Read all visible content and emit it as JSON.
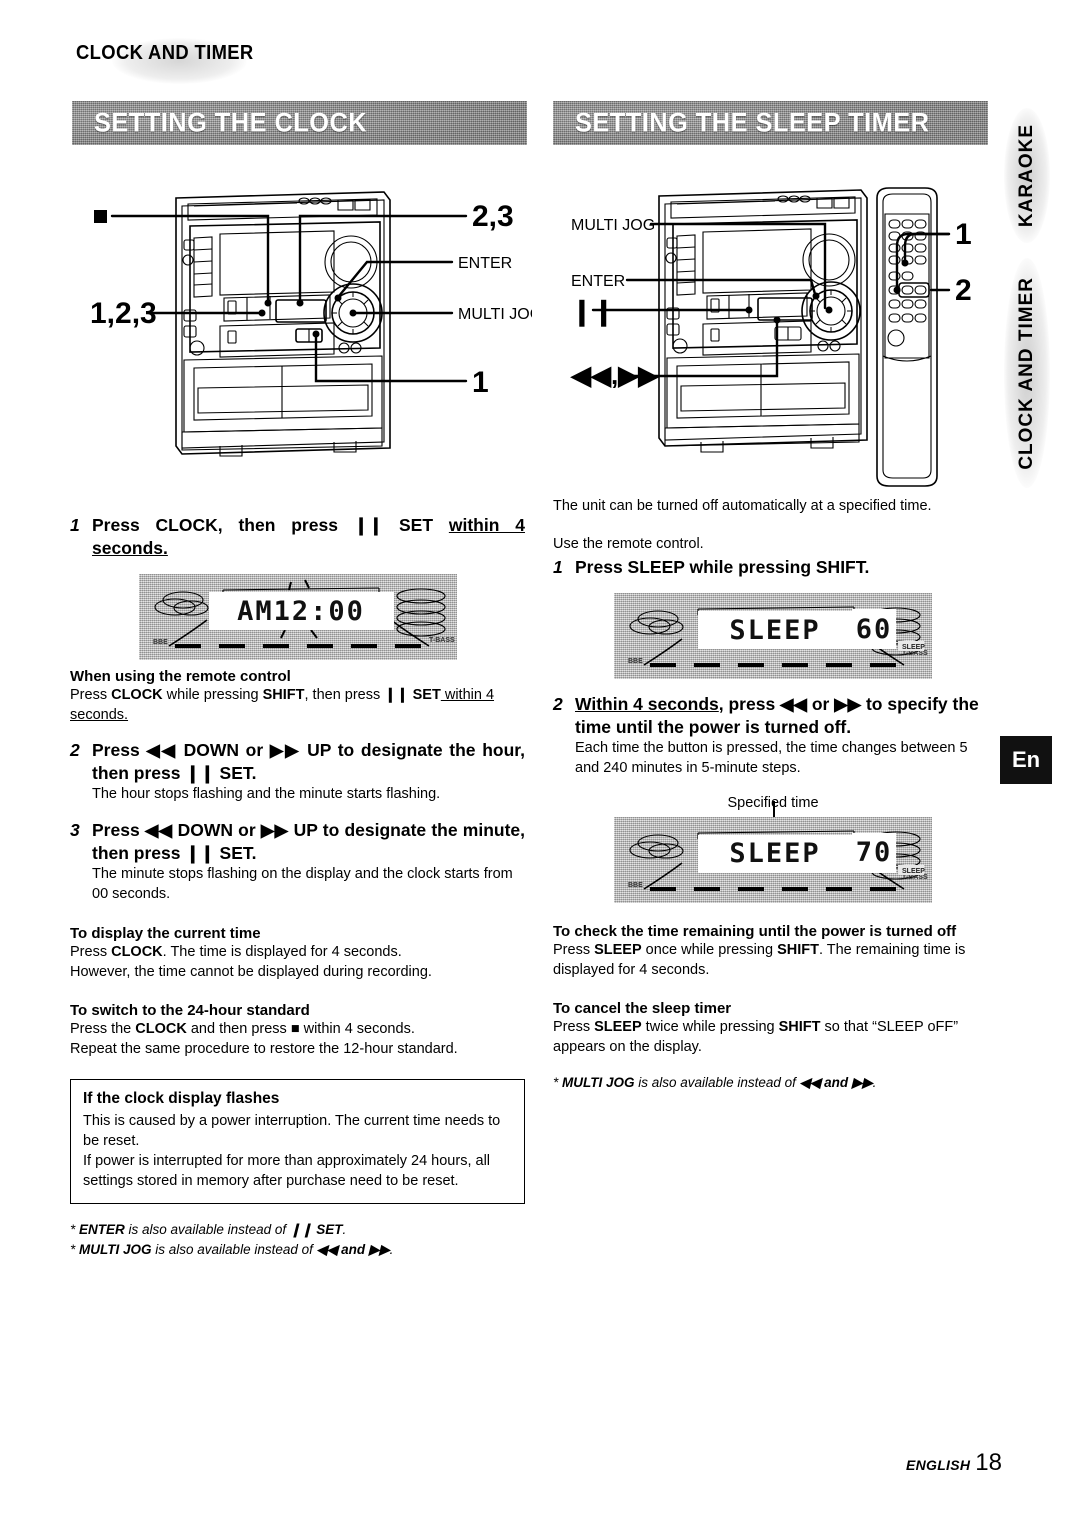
{
  "page": {
    "chapter_title": "CLOCK AND TIMER",
    "language_badge": "En",
    "footer_label": "ENGLISH",
    "footer_page": "18"
  },
  "side_tabs": [
    {
      "label": "KARAOKE"
    },
    {
      "label": "CLOCK AND TIMER"
    }
  ],
  "sections": {
    "clock": {
      "banner": "SETTING THE CLOCK",
      "diagram": {
        "callouts": [
          {
            "name": "stop-square-callout",
            "label": "■"
          },
          {
            "name": "steps-123-callout",
            "label": "1,2,3"
          },
          {
            "name": "steps-23-callout",
            "label": "2,3"
          },
          {
            "name": "enter-callout",
            "label": "ENTER"
          },
          {
            "name": "multi-jog-callout",
            "label": "MULTI JOG"
          },
          {
            "name": "step-1-callout",
            "label": "1"
          }
        ]
      },
      "step1": {
        "num": "1",
        "head_a": "Press CLOCK, then press ",
        "head_pause": "❙❙",
        "head_b": " SET ",
        "head_underline": "within 4 seconds."
      },
      "lcd1": {
        "main": "AM12",
        "sep": ":",
        "value": "00",
        "full": "AM12:00"
      },
      "remote_head": "When using the remote control",
      "remote_body_a": "Press ",
      "remote_body_clock": "CLOCK",
      "remote_body_b": " while pressing ",
      "remote_body_shift": "SHIFT",
      "remote_body_c": ", then press ",
      "remote_body_set": "❙❙ SET",
      "remote_body_u": " within 4 seconds.",
      "step2": {
        "num": "2",
        "head": "Press ◀◀ DOWN or ▶▶ UP to designate the hour, then press ❙❙ SET.",
        "body": "The hour stops flashing and the minute starts flashing."
      },
      "step3": {
        "num": "3",
        "head": "Press ◀◀ DOWN or ▶▶ UP to designate the minute, then press ❙❙ SET.",
        "body": "The minute stops flashing on the display and the clock starts from 00 seconds."
      },
      "display_time": {
        "head": "To display the current time",
        "line1_a": "Press ",
        "line1_b": "CLOCK",
        "line1_c": ".  The time is displayed for 4 seconds.",
        "line2": "However, the time cannot be displayed during recording."
      },
      "switch_24h": {
        "head": "To switch to the 24-hour standard",
        "line1_a": "Press the ",
        "line1_b": "CLOCK",
        "line1_c": " and then press ■ within 4 seconds.",
        "line2": "Repeat the same procedure to restore the 12-hour standard."
      },
      "note_box": {
        "title": "If the clock display flashes",
        "p1": "This is caused by a power interruption. The current time needs to be reset.",
        "p2": "If power is interrupted for more than approximately 24 hours, all settings stored in memory after purchase need to be reset."
      },
      "footnotes": [
        {
          "bold": "ENTER",
          "text_a": " is also available instead of ",
          "bold2": "❙❙ SET",
          "text_b": "."
        },
        {
          "bold": "MULTI JOG",
          "text_a": " is also available instead of ",
          "bold2": "◀◀ and ▶▶",
          "text_b": "."
        }
      ]
    },
    "sleep": {
      "banner": "SETTING THE SLEEP TIMER",
      "diagram": {
        "callouts": [
          {
            "name": "multi-jog-callout",
            "label": "MULTI JOG"
          },
          {
            "name": "enter-callout",
            "label": "ENTER"
          },
          {
            "name": "pause-callout",
            "label": "❙❙"
          },
          {
            "name": "skip-callout",
            "label": "◀◀,▶▶"
          },
          {
            "name": "step-1-callout",
            "label": "1"
          },
          {
            "name": "step-2-callout",
            "label": "2"
          }
        ]
      },
      "intro": "The unit can be turned off automatically at a specified time.",
      "use_remote": "Use the remote control.",
      "step1": {
        "num": "1",
        "head": "Press SLEEP while pressing SHIFT."
      },
      "lcd1": {
        "main": "SLEEP",
        "value": "60",
        "full": "SLEEP 60"
      },
      "step2": {
        "num": "2",
        "head_u": "Within 4 seconds",
        "head_rest": ", press ◀◀ or ▶▶ to specify the time until the power is turned off.",
        "body": "Each time the button is pressed, the time changes between 5 and 240 minutes in 5-minute steps."
      },
      "specified_time_label": "Specified time",
      "lcd2": {
        "main": "SLEEP",
        "value": "70",
        "full": "SLEEP 70"
      },
      "check_remaining": {
        "head": "To check the time remaining until the power is turned off",
        "line_a": "Press ",
        "line_b": "SLEEP",
        "line_c": " once while pressing ",
        "line_d": "SHIFT",
        "line_e": ".  The remaining time is displayed for 4 seconds."
      },
      "cancel": {
        "head": "To cancel the sleep timer",
        "line_a": "Press ",
        "line_b": "SLEEP",
        "line_c": " twice while pressing ",
        "line_d": "SHIFT",
        "line_e": " so that “SLEEP oFF” appears on the display."
      },
      "footnotes": [
        {
          "bold": "MULTI JOG",
          "text_a": " is also available instead of ",
          "bold2": "◀◀ and ▶▶",
          "text_b": "."
        }
      ]
    }
  }
}
